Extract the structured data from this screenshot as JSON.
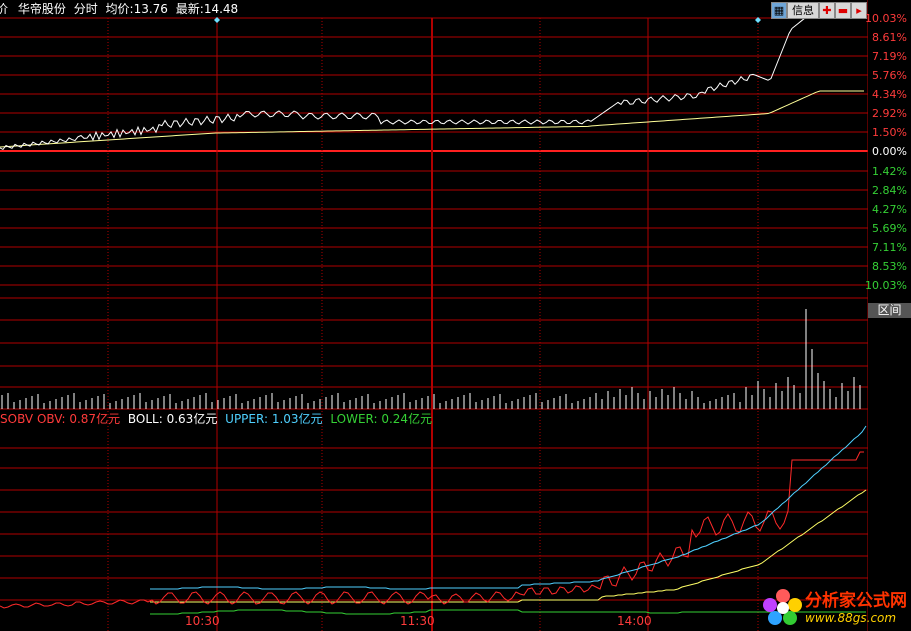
{
  "header": {
    "left_glyph": "价",
    "stock_name": "华帝股份",
    "mode": "分时",
    "avg_label": "均价:",
    "avg_value": "13.76",
    "last_label": "最新:",
    "last_value": "14.48"
  },
  "toolbar": {
    "info_label": "信息",
    "range_label": "区间"
  },
  "price_axis": {
    "up": [
      "10.03%",
      "8.61%",
      "7.19%",
      "5.76%",
      "4.34%",
      "2.92%",
      "1.50%"
    ],
    "zero": "0.00%",
    "down": [
      "1.42%",
      "2.84%",
      "4.27%",
      "5.69%",
      "7.11%",
      "8.53%",
      "10.03%"
    ]
  },
  "indicator": {
    "obv_label": "SOBV OBV: 0.87亿元",
    "boll_label": "BOLL: 0.63亿元",
    "upper_label": "UPPER: 1.03亿元",
    "lower_label": "LOWER: 0.24亿元"
  },
  "time_axis": [
    "10:30",
    "11:30",
    "14:00"
  ],
  "watermark": {
    "title": "分析家公式网",
    "url": "www.88gs.com"
  },
  "colors": {
    "grid_red": "#b00000",
    "price_line": "#ffffff",
    "avg_line": "#ffff99",
    "obv_line": "#ff2a2a",
    "boll_line": "#ffff66",
    "upper_line": "#4fd0ff",
    "lower_line": "#35d035",
    "volume_bar": "#ffffff"
  }
}
